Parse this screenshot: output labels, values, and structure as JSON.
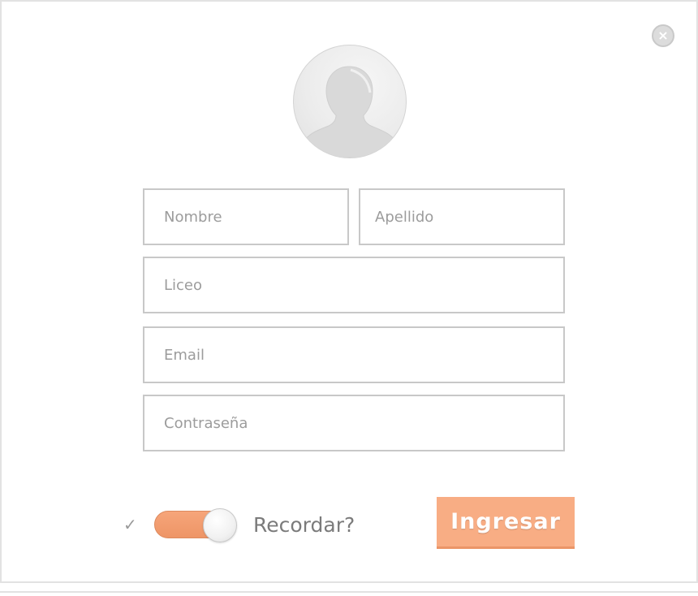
{
  "close_button": {
    "glyph": "×",
    "icon": "close-icon"
  },
  "avatar": {
    "icon": "user-silhouette-icon"
  },
  "form": {
    "fields": {
      "nombre": {
        "placeholder": "Nombre",
        "value": ""
      },
      "apellido": {
        "placeholder": "Apellido",
        "value": ""
      },
      "liceo": {
        "placeholder": "Liceo",
        "value": ""
      },
      "email": {
        "placeholder": "Email",
        "value": ""
      },
      "password": {
        "placeholder": "Contraseña",
        "value": ""
      }
    },
    "remember": {
      "check_glyph": "✓",
      "label": "Recordar?",
      "enabled": true
    },
    "submit_label": "Ingresar"
  },
  "colors": {
    "accent": "#f8ad84",
    "toggle_track": "#f6a57a",
    "field_border": "#c8c8c8",
    "close_bg": "#dcdcdc"
  }
}
